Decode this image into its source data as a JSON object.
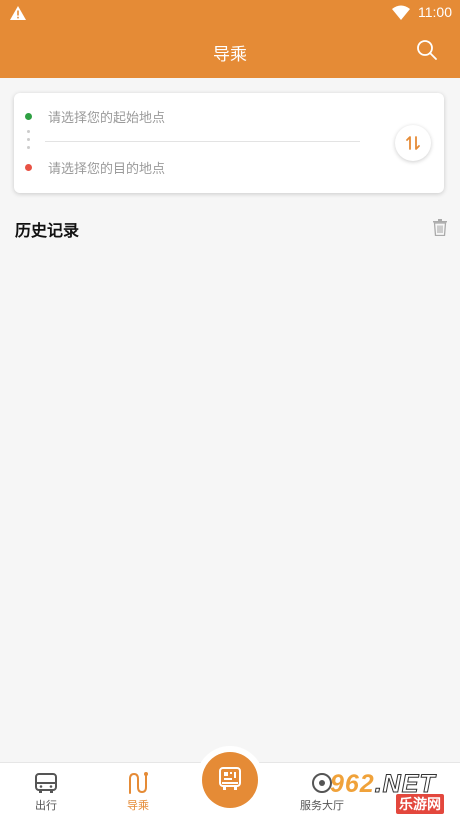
{
  "status": {
    "time": "11:00"
  },
  "appbar": {
    "title": "导乘"
  },
  "route": {
    "start_placeholder": "请选择您的起始地点",
    "end_placeholder": "请选择您的目的地点"
  },
  "history": {
    "title": "历史记录"
  },
  "tabs": [
    {
      "label": "出行",
      "icon": "bus-icon"
    },
    {
      "label": "导乘",
      "icon": "route-icon",
      "active": true
    },
    {
      "label": "",
      "icon": "qr-code-bus-icon"
    },
    {
      "label": "服务大厅",
      "icon": "service-hall-icon"
    }
  ],
  "watermark": {
    "brand": "962",
    "suffix": ".NET",
    "site": "乐游网"
  },
  "colors": {
    "accent": "#e58b36",
    "start_dot": "#2ea043",
    "end_dot": "#e85244"
  }
}
